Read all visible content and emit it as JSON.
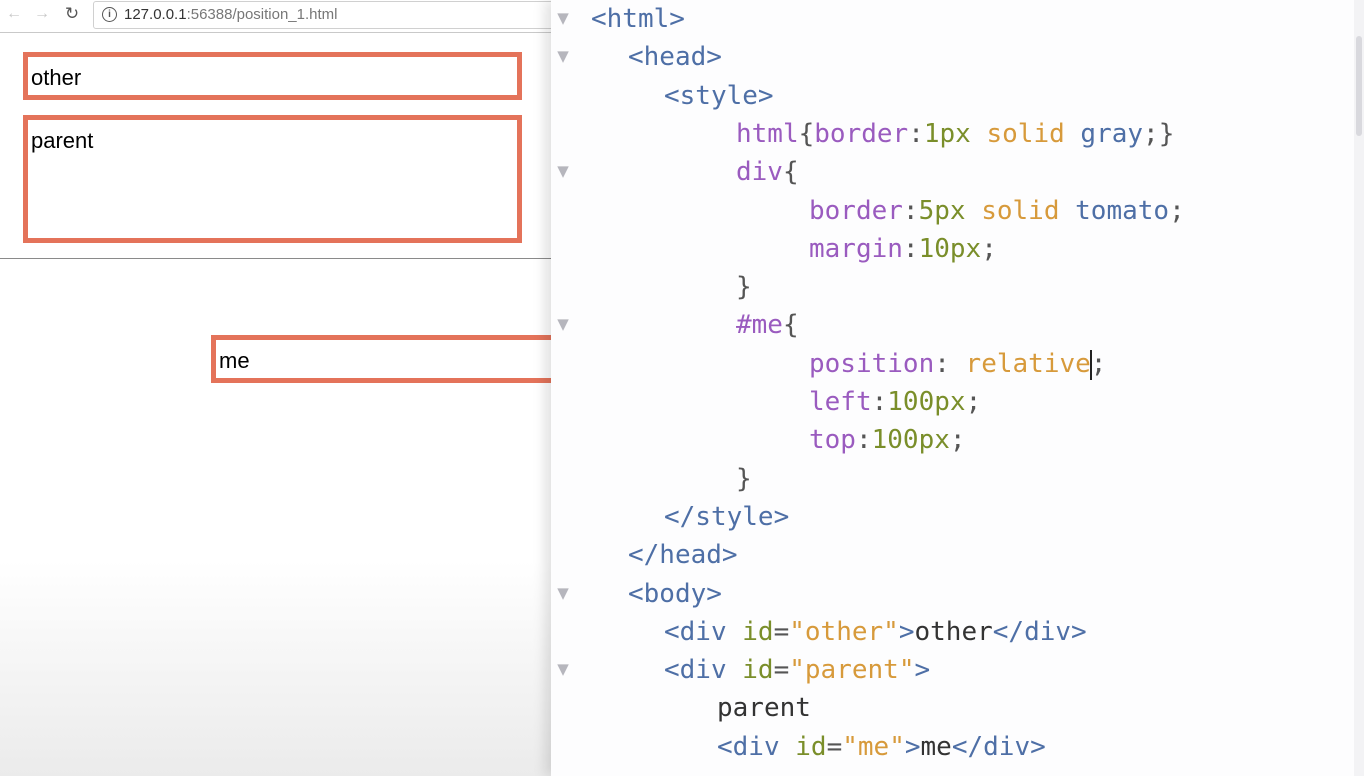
{
  "browser": {
    "url_host": "127.0.0.1",
    "url_rest": ":56388/position_1.html",
    "nav": {
      "back_icon": "←",
      "forward_icon": "→",
      "reload_icon": "↻",
      "info_icon": "i"
    },
    "boxes": {
      "other": "other",
      "parent": "parent",
      "me": "me"
    }
  },
  "colors": {
    "tomato_border": "#e4735a",
    "tag": "#4e6fa6",
    "attr": "#7a8e2a",
    "value": "#d79a3b",
    "property": "#9a5bbf"
  },
  "editor": {
    "fold_glyph": "▼",
    "lines": [
      {
        "tokens": [
          {
            "t": "<html>",
            "c": "tag"
          }
        ]
      },
      {
        "tokens": [
          {
            "t": "<head>",
            "c": "tag"
          }
        ]
      },
      {
        "tokens": [
          {
            "t": "<style>",
            "c": "tag"
          }
        ]
      },
      {
        "tokens": [
          {
            "t": "html",
            "c": "prop"
          },
          {
            "t": "{",
            "c": "punc"
          },
          {
            "t": "border",
            "c": "prop"
          },
          {
            "t": ":",
            "c": "punc"
          },
          {
            "t": "1px",
            "c": "num"
          },
          {
            "t": " ",
            "c": "punc"
          },
          {
            "t": "solid",
            "c": "kw"
          },
          {
            "t": " ",
            "c": "punc"
          },
          {
            "t": "gray",
            "c": "kw2"
          },
          {
            "t": ";}",
            "c": "punc"
          }
        ]
      },
      {
        "tokens": [
          {
            "t": "div",
            "c": "prop"
          },
          {
            "t": "{",
            "c": "punc"
          }
        ]
      },
      {
        "tokens": [
          {
            "t": "border",
            "c": "prop"
          },
          {
            "t": ":",
            "c": "punc"
          },
          {
            "t": "5px",
            "c": "num"
          },
          {
            "t": " ",
            "c": "punc"
          },
          {
            "t": "solid",
            "c": "kw"
          },
          {
            "t": " ",
            "c": "punc"
          },
          {
            "t": "tomato",
            "c": "kw2"
          },
          {
            "t": ";",
            "c": "punc"
          }
        ]
      },
      {
        "tokens": [
          {
            "t": "margin",
            "c": "prop"
          },
          {
            "t": ":",
            "c": "punc"
          },
          {
            "t": "10px",
            "c": "num"
          },
          {
            "t": ";",
            "c": "punc"
          }
        ]
      },
      {
        "tokens": [
          {
            "t": "}",
            "c": "punc"
          }
        ]
      },
      {
        "tokens": [
          {
            "t": "#me",
            "c": "prop"
          },
          {
            "t": "{",
            "c": "punc"
          }
        ]
      },
      {
        "tokens": [
          {
            "t": "position",
            "c": "prop"
          },
          {
            "t": ": ",
            "c": "punc"
          },
          {
            "t": "relative",
            "c": "kw"
          },
          {
            "t": "|",
            "c": "caret"
          },
          {
            "t": ";",
            "c": "punc"
          }
        ]
      },
      {
        "tokens": [
          {
            "t": "left",
            "c": "prop"
          },
          {
            "t": ":",
            "c": "punc"
          },
          {
            "t": "100px",
            "c": "num"
          },
          {
            "t": ";",
            "c": "punc"
          }
        ]
      },
      {
        "tokens": [
          {
            "t": "top",
            "c": "prop"
          },
          {
            "t": ":",
            "c": "punc"
          },
          {
            "t": "100px",
            "c": "num"
          },
          {
            "t": ";",
            "c": "punc"
          }
        ]
      },
      {
        "tokens": [
          {
            "t": "}",
            "c": "punc"
          }
        ]
      },
      {
        "tokens": [
          {
            "t": "</style>",
            "c": "tag"
          }
        ]
      },
      {
        "tokens": [
          {
            "t": "</head>",
            "c": "tag"
          }
        ]
      },
      {
        "tokens": [
          {
            "t": "<body>",
            "c": "tag"
          }
        ]
      },
      {
        "tokens": [
          {
            "t": "<div ",
            "c": "tag"
          },
          {
            "t": "id",
            "c": "attr"
          },
          {
            "t": "=",
            "c": "punc"
          },
          {
            "t": "\"other\"",
            "c": "val"
          },
          {
            "t": ">",
            "c": "tag"
          },
          {
            "t": "other",
            "c": "text"
          },
          {
            "t": "</div>",
            "c": "tag"
          }
        ]
      },
      {
        "tokens": [
          {
            "t": "<div ",
            "c": "tag"
          },
          {
            "t": "id",
            "c": "attr"
          },
          {
            "t": "=",
            "c": "punc"
          },
          {
            "t": "\"parent\"",
            "c": "val"
          },
          {
            "t": ">",
            "c": "tag"
          }
        ]
      },
      {
        "tokens": [
          {
            "t": "parent",
            "c": "text"
          }
        ]
      },
      {
        "tokens": [
          {
            "t": "<div ",
            "c": "tag"
          },
          {
            "t": "id",
            "c": "attr"
          },
          {
            "t": "=",
            "c": "punc"
          },
          {
            "t": "\"me\"",
            "c": "val"
          },
          {
            "t": ">",
            "c": "tag"
          },
          {
            "t": "me",
            "c": "text"
          },
          {
            "t": "</div>",
            "c": "tag"
          }
        ]
      }
    ]
  }
}
